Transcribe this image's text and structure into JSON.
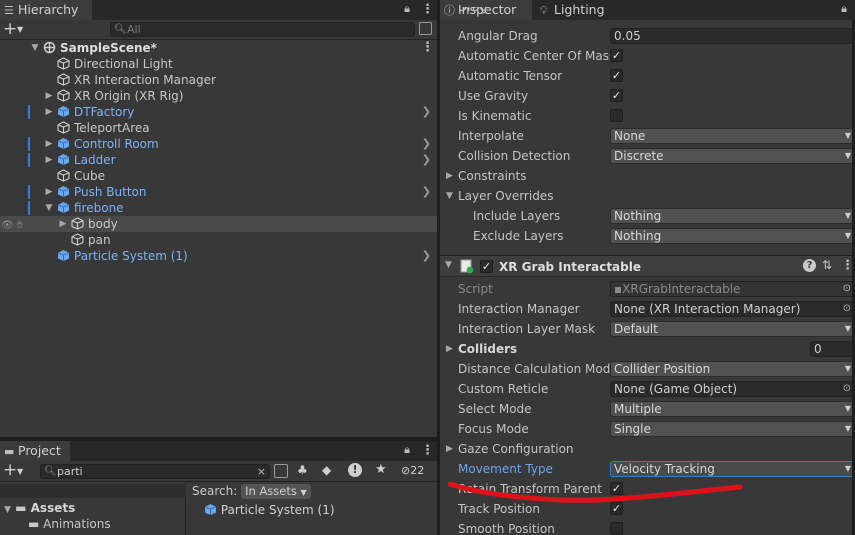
{
  "hierarchy": {
    "tab_label": "Hierarchy",
    "search_placeholder": "All",
    "items": [
      {
        "label": "SampleScene*",
        "depth": 0,
        "fold": "open",
        "kind": "scene"
      },
      {
        "label": "Directional Light",
        "depth": 1,
        "fold": "",
        "kind": "object"
      },
      {
        "label": "XR Interaction Manager",
        "depth": 1,
        "fold": "",
        "kind": "object"
      },
      {
        "label": "XR Origin (XR Rig)",
        "depth": 1,
        "fold": "closed",
        "kind": "object"
      },
      {
        "label": "DTFactory",
        "depth": 1,
        "fold": "closed",
        "kind": "prefab",
        "chevron": true,
        "edge": true
      },
      {
        "label": "TeleportArea",
        "depth": 1,
        "fold": "",
        "kind": "object"
      },
      {
        "label": "Controll Room",
        "depth": 1,
        "fold": "closed",
        "kind": "prefab",
        "chevron": true,
        "edge": true
      },
      {
        "label": "Ladder",
        "depth": 1,
        "fold": "closed",
        "kind": "prefab",
        "chevron": true,
        "edge": true
      },
      {
        "label": "Cube",
        "depth": 1,
        "fold": "",
        "kind": "object"
      },
      {
        "label": "Push Button",
        "depth": 1,
        "fold": "closed",
        "kind": "prefab",
        "chevron": true,
        "edge": true
      },
      {
        "label": "firebone",
        "depth": 1,
        "fold": "open",
        "kind": "prefab",
        "edge": true
      },
      {
        "label": "body",
        "depth": 2,
        "fold": "closed",
        "kind": "object",
        "selected": true
      },
      {
        "label": "pan",
        "depth": 2,
        "fold": "",
        "kind": "object"
      },
      {
        "label": "Particle System (1)",
        "depth": 1,
        "fold": "",
        "kind": "prefab",
        "chevron": true
      }
    ]
  },
  "project": {
    "tab_label": "Project",
    "search_value": "parti",
    "hidden_count": "22",
    "assets_label": "Assets",
    "animations_label": "Animations",
    "search_label": "Search:",
    "search_scope": "In Assets",
    "result_item": "Particle System (1)"
  },
  "inspector": {
    "tabs": [
      {
        "label": "Inspector"
      },
      {
        "label": "Lighting"
      }
    ],
    "partial_top": "Drag",
    "rows": [
      {
        "label": "Angular Drag",
        "type": "field",
        "value": "0.05"
      },
      {
        "label": "Automatic Center Of Mass",
        "type": "check",
        "checked": true
      },
      {
        "label": "Automatic Tensor",
        "type": "check",
        "checked": true
      },
      {
        "label": "Use Gravity",
        "type": "check",
        "checked": true
      },
      {
        "label": "Is Kinematic",
        "type": "check",
        "checked": false
      },
      {
        "label": "Interpolate",
        "type": "dropdown",
        "value": "None"
      },
      {
        "label": "Collision Detection",
        "type": "dropdown",
        "value": "Discrete"
      },
      {
        "label": "Constraints",
        "type": "foldout",
        "fold": "closed"
      },
      {
        "label": "Layer Overrides",
        "type": "foldout",
        "fold": "open"
      },
      {
        "label": "Include Layers",
        "type": "dropdown",
        "value": "Nothing",
        "indent": true
      },
      {
        "label": "Exclude Layers",
        "type": "dropdown",
        "value": "Nothing",
        "indent": true
      }
    ],
    "component": {
      "title": "XR Grab Interactable",
      "enabled": true,
      "rows": [
        {
          "label": "Script",
          "type": "object",
          "value": "XRGrabInteractable",
          "dim": true
        },
        {
          "label": "Interaction Manager",
          "type": "object",
          "value": "None (XR Interaction Manager)"
        },
        {
          "label": "Interaction Layer Mask",
          "type": "dropdown",
          "value": "Default"
        },
        {
          "label": "Colliders",
          "type": "array",
          "value": "0",
          "bold": true
        },
        {
          "label": "Distance Calculation Mode",
          "type": "dropdown",
          "value": "Collider Position"
        },
        {
          "label": "Custom Reticle",
          "type": "object",
          "value": "None (Game Object)"
        },
        {
          "label": "Select Mode",
          "type": "dropdown",
          "value": "Multiple"
        },
        {
          "label": "Focus Mode",
          "type": "dropdown",
          "value": "Single"
        },
        {
          "label": "Gaze Configuration",
          "type": "foldout",
          "fold": "closed"
        },
        {
          "label": "Movement Type",
          "type": "dropdown",
          "value": "Velocity Tracking",
          "highlight": true
        },
        {
          "label": "Retain Transform Parent",
          "type": "check",
          "checked": true
        },
        {
          "label": "Track Position",
          "type": "check",
          "checked": true
        },
        {
          "label": "Smooth Position",
          "type": "check",
          "checked": false
        }
      ]
    }
  },
  "colors": {
    "prefab_blue": "#7fb3f5",
    "annotation_red": "#e0101a",
    "highlight_blue": "#3a79d1"
  }
}
